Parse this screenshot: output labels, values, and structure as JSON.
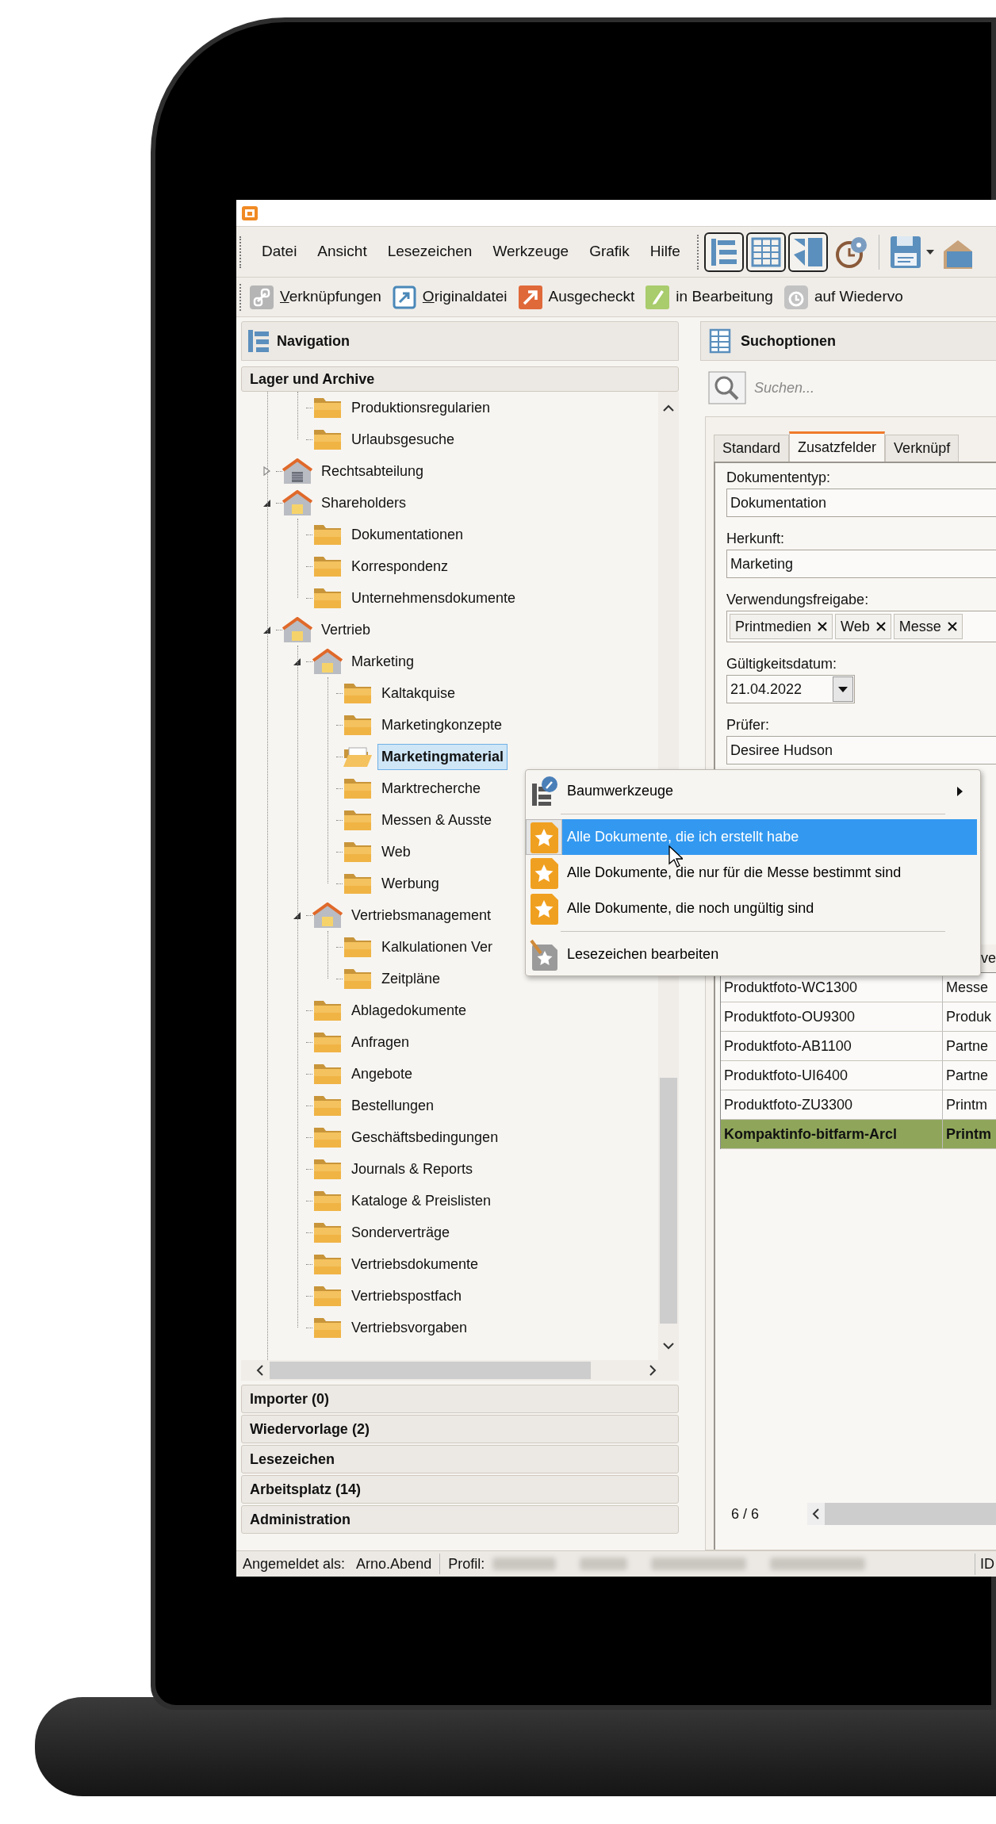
{
  "menu_bar": {
    "items": [
      "Datei",
      "Ansicht",
      "Lesezeichen",
      "Werkzeuge",
      "Grafik",
      "Hilfe"
    ]
  },
  "toolbar": [
    {
      "kind": "link",
      "label": "Verknüpfungen",
      "mnemonic": true
    },
    {
      "kind": "original",
      "label": "Originaldatei",
      "mnemonic": true
    },
    {
      "kind": "checkout",
      "label": "Ausgecheckt",
      "mnemonic": false
    },
    {
      "kind": "editing",
      "label": "in Bearbeitung",
      "mnemonic": false
    },
    {
      "kind": "resubmit",
      "label": "auf Wiedervo",
      "mnemonic": false
    }
  ],
  "navigation": {
    "title": "Navigation",
    "section": "Lager und Archive",
    "tree": [
      {
        "children": [
          {
            "kind": "folder",
            "label": "Produktionsregularien",
            "selected": false
          },
          {
            "kind": "folder",
            "label": "Urlaubsgesuche",
            "selected": false
          }
        ]
      },
      {
        "kind": "cabinet",
        "label": "Rechtsabteilung",
        "selected": false,
        "expanded": false
      },
      {
        "kind": "cabinet",
        "label": "Shareholders",
        "selected": false,
        "expanded": true,
        "children": [
          {
            "kind": "folder",
            "label": "Dokumentationen",
            "selected": false
          },
          {
            "kind": "folder",
            "label": "Korrespondenz",
            "selected": false
          },
          {
            "kind": "folder",
            "label": "Unternehmensdokumente",
            "selected": false
          }
        ]
      },
      {
        "kind": "cabinet",
        "label": "Vertrieb",
        "selected": false,
        "expanded": true,
        "children": [
          {
            "kind": "cabinet",
            "label": "Marketing",
            "selected": false,
            "expanded": true,
            "children": [
              {
                "kind": "folder",
                "label": "Kaltakquise",
                "selected": false
              },
              {
                "kind": "folder",
                "label": "Marketingkonzepte",
                "selected": false
              },
              {
                "kind": "folder",
                "label": "Marketingmaterial",
                "selected": true
              },
              {
                "kind": "folder",
                "label": "Marktrecherche",
                "selected": false
              },
              {
                "kind": "folder",
                "label": "Messen & Ausste",
                "selected": false
              },
              {
                "kind": "folder",
                "label": "Web",
                "selected": false
              },
              {
                "kind": "folder",
                "label": "Werbung",
                "selected": false
              }
            ]
          },
          {
            "kind": "cabinet",
            "label": "Vertriebsmanagement",
            "selected": false,
            "expanded": true,
            "children": [
              {
                "kind": "folder",
                "label": "Kalkulationen Ver",
                "selected": false
              },
              {
                "kind": "folder",
                "label": "Zeitpläne",
                "selected": false
              }
            ]
          },
          {
            "kind": "folder",
            "label": "Ablagedokumente",
            "selected": false
          },
          {
            "kind": "folder",
            "label": "Anfragen",
            "selected": false
          },
          {
            "kind": "folder",
            "label": "Angebote",
            "selected": false
          },
          {
            "kind": "folder",
            "label": "Bestellungen",
            "selected": false
          },
          {
            "kind": "folder",
            "label": "Geschäftsbedingungen",
            "selected": false
          },
          {
            "kind": "folder",
            "label": "Journals & Reports",
            "selected": false
          },
          {
            "kind": "folder",
            "label": "Kataloge & Preislisten",
            "selected": false
          },
          {
            "kind": "folder",
            "label": "Sonderverträge",
            "selected": false
          },
          {
            "kind": "folder",
            "label": "Vertriebsdokumente",
            "selected": false
          },
          {
            "kind": "folder",
            "label": "Vertriebspostfach",
            "selected": false
          },
          {
            "kind": "folder",
            "label": "Vertriebsvorgaben",
            "selected": false
          }
        ]
      }
    ],
    "sections": [
      "Importer (0)",
      "Wiedervorlage (2)",
      "Lesezeichen",
      "Arbeitsplatz (14)",
      "Administration"
    ]
  },
  "search_panel": {
    "title": "Suchoptionen",
    "search": {
      "placeholder": "Suchen..."
    },
    "tabs": [
      {
        "label": "Standard",
        "selected": false
      },
      {
        "label": "Zusatzfelder",
        "selected": true
      },
      {
        "label": "Verknüpf",
        "selected": false
      }
    ],
    "fields": [
      {
        "kind": "text",
        "label": "Dokumententyp:",
        "value": "Dokumentation"
      },
      {
        "kind": "text",
        "label": "Herkunft:",
        "value": "Marketing"
      },
      {
        "kind": "tags",
        "label": "Verwendungsfreigabe:",
        "tags": [
          "Printmedien",
          "Web",
          "Messe"
        ]
      },
      {
        "kind": "date",
        "label": "Gültigkeitsdatum:",
        "value": "21.04.2022"
      },
      {
        "kind": "text",
        "label": "Prüfer:",
        "value": "Desiree Hudson"
      }
    ],
    "table": {
      "column_2": "ve",
      "rows": [
        {
          "cells": [
            "Produktfoto-WC1300",
            "Messe"
          ],
          "highlighted": false
        },
        {
          "cells": [
            "Produktfoto-OU9300",
            "Produk"
          ],
          "highlighted": false
        },
        {
          "cells": [
            "Produktfoto-AB1100",
            "Partne"
          ],
          "highlighted": false
        },
        {
          "cells": [
            "Produktfoto-UI6400",
            "Partne"
          ],
          "highlighted": false
        },
        {
          "cells": [
            "Produktfoto-ZU3300",
            "Printm"
          ],
          "highlighted": false
        },
        {
          "cells": [
            "Kompaktinfo-bitfarm-Arcl",
            "Printm"
          ],
          "highlighted": true
        }
      ],
      "count": "6 / 6"
    }
  },
  "context_menu": {
    "items": [
      {
        "kind": "submenu",
        "label": "Baumwerkzeuge",
        "selected": false
      },
      {
        "kind": "separator"
      },
      {
        "kind": "bookmark",
        "label": "Alle Dokumente, die ich erstellt habe",
        "selected": true
      },
      {
        "kind": "bookmark",
        "label": "Alle Dokumente, die nur für die Messe bestimmt sind",
        "selected": false
      },
      {
        "kind": "bookmark",
        "label": "Alle Dokumente, die noch ungültig sind",
        "selected": false
      },
      {
        "kind": "separator"
      },
      {
        "kind": "edit",
        "label": "Lesezeichen bearbeiten",
        "selected": false
      }
    ]
  },
  "status_bar": {
    "label": "Angemeldet als:",
    "user": "Arno.Abend",
    "profile_label": "Profil:",
    "id_label": "ID"
  }
}
